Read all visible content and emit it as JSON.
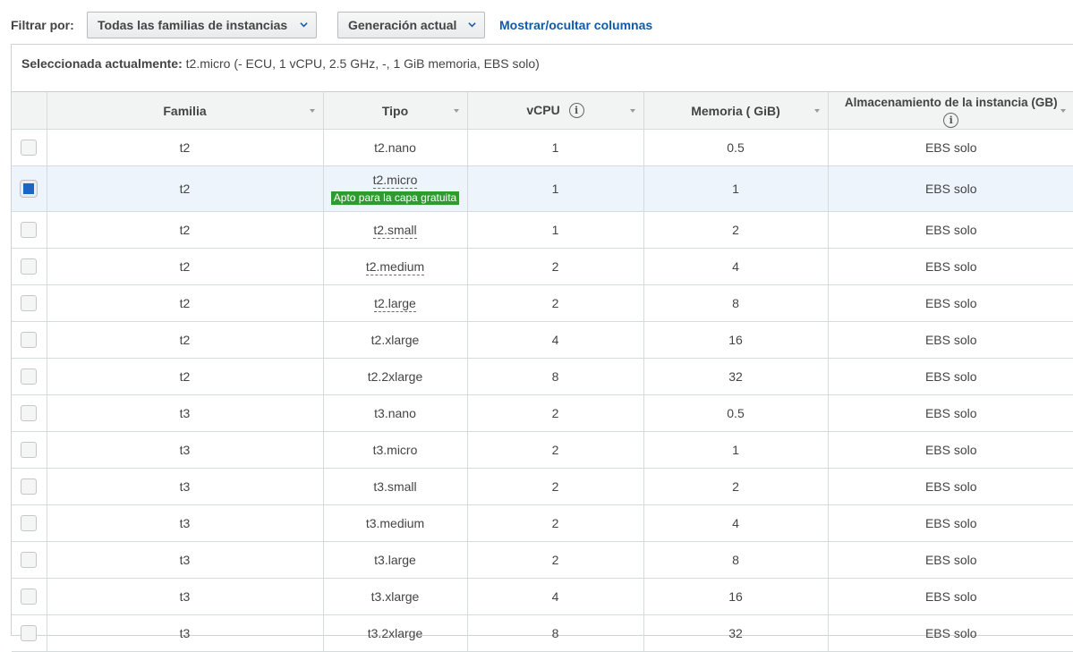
{
  "filter": {
    "label": "Filtrar por:",
    "family_select": "Todas las familias de instancias",
    "generation_select": "Generación actual",
    "toggle_columns": "Mostrar/ocultar columnas"
  },
  "current": {
    "label": "Seleccionada actualmente:",
    "value": "t2.micro (- ECU, 1 vCPU, 2.5 GHz, -, 1  GiB memoria, EBS solo)"
  },
  "table": {
    "headers": {
      "family": "Familia",
      "type": "Tipo",
      "vcpu": "vCPU",
      "memory": "Memoria ( GiB)",
      "storage": "Almacenamiento de la instancia (GB)"
    },
    "free_tier_badge": "Apto para la capa gratuita",
    "rows": [
      {
        "family": "t2",
        "type": "t2.nano",
        "vcpu": "1",
        "memory": "0.5",
        "storage": "EBS solo"
      },
      {
        "family": "t2",
        "type": "t2.micro",
        "vcpu": "1",
        "memory": "1",
        "storage": "EBS solo"
      },
      {
        "family": "t2",
        "type": "t2.small",
        "vcpu": "1",
        "memory": "2",
        "storage": "EBS solo"
      },
      {
        "family": "t2",
        "type": "t2.medium",
        "vcpu": "2",
        "memory": "4",
        "storage": "EBS solo"
      },
      {
        "family": "t2",
        "type": "t2.large",
        "vcpu": "2",
        "memory": "8",
        "storage": "EBS solo"
      },
      {
        "family": "t2",
        "type": "t2.xlarge",
        "vcpu": "4",
        "memory": "16",
        "storage": "EBS solo"
      },
      {
        "family": "t2",
        "type": "t2.2xlarge",
        "vcpu": "8",
        "memory": "32",
        "storage": "EBS solo"
      },
      {
        "family": "t3",
        "type": "t3.nano",
        "vcpu": "2",
        "memory": "0.5",
        "storage": "EBS solo"
      },
      {
        "family": "t3",
        "type": "t3.micro",
        "vcpu": "2",
        "memory": "1",
        "storage": "EBS solo"
      },
      {
        "family": "t3",
        "type": "t3.small",
        "vcpu": "2",
        "memory": "2",
        "storage": "EBS solo"
      },
      {
        "family": "t3",
        "type": "t3.medium",
        "vcpu": "2",
        "memory": "4",
        "storage": "EBS solo"
      },
      {
        "family": "t3",
        "type": "t3.large",
        "vcpu": "2",
        "memory": "8",
        "storage": "EBS solo"
      },
      {
        "family": "t3",
        "type": "t3.xlarge",
        "vcpu": "4",
        "memory": "16",
        "storage": "EBS solo"
      },
      {
        "family": "t3",
        "type": "t3.2xlarge",
        "vcpu": "8",
        "memory": "32",
        "storage": "EBS solo"
      }
    ]
  }
}
